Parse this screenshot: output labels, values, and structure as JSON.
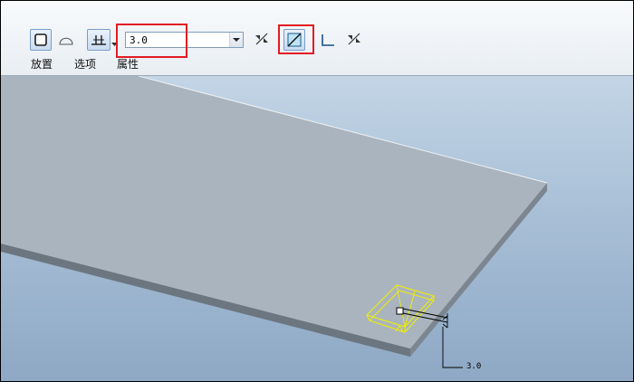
{
  "toolbar": {
    "depth_value": "3.0",
    "tabs": [
      {
        "label": "放置"
      },
      {
        "label": "选项"
      },
      {
        "label": "属性"
      }
    ]
  },
  "viewport": {
    "dimension_label": "3.0"
  },
  "colors": {
    "highlight": "#e21b23",
    "plate_top": "#aab4be",
    "feature": "#f0f000"
  }
}
